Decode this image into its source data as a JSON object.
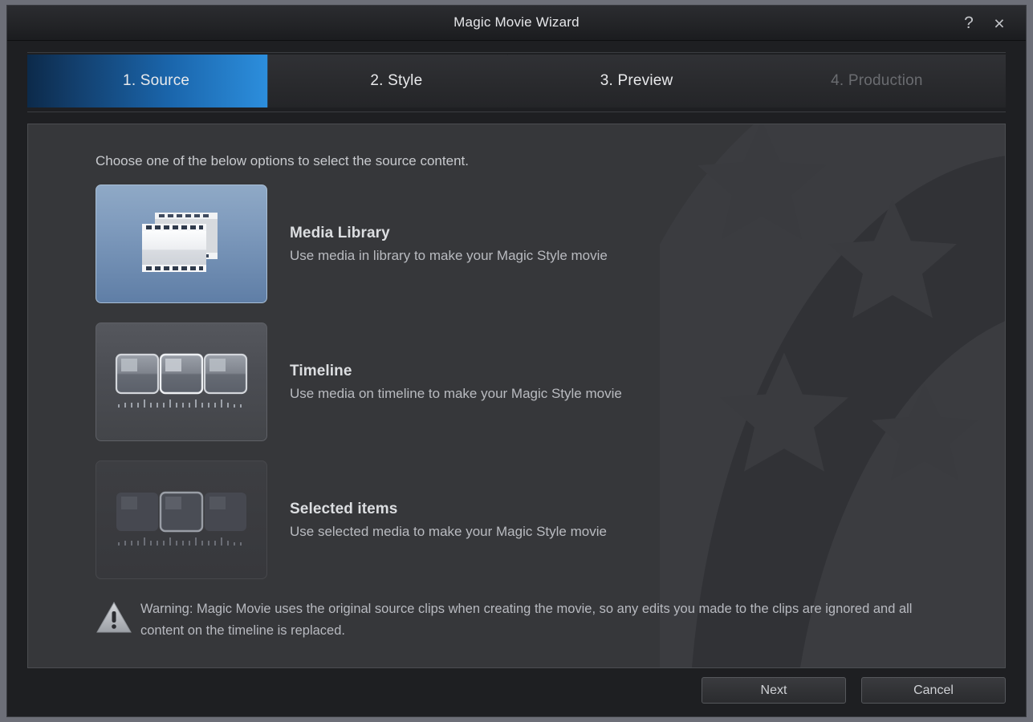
{
  "window": {
    "title": "Magic Movie Wizard",
    "help_icon": "question-mark-icon",
    "help_label": "?",
    "close_icon": "close-icon",
    "close_label": "×"
  },
  "steps": [
    {
      "label": "1. Source",
      "state": "active"
    },
    {
      "label": "2. Style",
      "state": "inactive"
    },
    {
      "label": "3. Preview",
      "state": "inactive"
    },
    {
      "label": "4. Production",
      "state": "disabled"
    }
  ],
  "main": {
    "intro": "Choose one of the below options to select the source content.",
    "options": [
      {
        "title": "Media Library",
        "desc": "Use media in library to make your Magic Style movie",
        "icon": "film-strip-icon",
        "selected": true
      },
      {
        "title": "Timeline",
        "desc": "Use media on timeline to make your Magic Style movie",
        "icon": "timeline-clips-icon",
        "selected": false
      },
      {
        "title": "Selected items",
        "desc": "Use selected media to make your Magic Style movie",
        "icon": "selected-clip-icon",
        "selected": false
      }
    ],
    "warning": {
      "icon": "warning-triangle-icon",
      "text": "Warning: Magic Movie uses the original source clips when creating the movie, so any edits you made to the clips are ignored and all content on the timeline is replaced."
    }
  },
  "footer": {
    "next_label": "Next",
    "cancel_label": "Cancel"
  },
  "colors": {
    "accent": "#1d6cb5",
    "accent_bright": "#2d90df",
    "window_bg": "#1e1f22",
    "panel_bg": "#36373a",
    "tile_selected": "#7f9bbd",
    "text_primary": "#dcdee1",
    "text_secondary": "#b9bbc0",
    "text_disabled": "#6a6c70"
  }
}
